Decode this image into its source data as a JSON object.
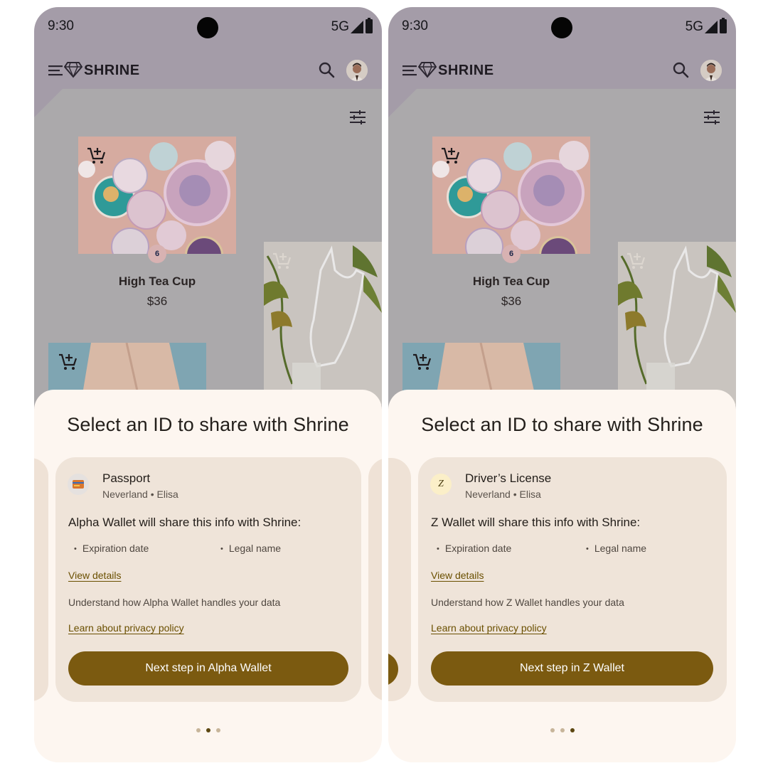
{
  "screens": [
    {
      "status": {
        "time": "9:30",
        "network": "5G"
      },
      "app": {
        "brand": "SHRINE"
      },
      "product": {
        "name": "High Tea Cup",
        "price": "$36",
        "badge": "6"
      },
      "dialog": {
        "title": "Select an ID to share with Shrine",
        "card": {
          "id_name": "Passport",
          "id_subtitle": "Neverland • Elisa",
          "icon": "passport-icon",
          "share_heading": "Alpha Wallet will share this info with Shrine:",
          "attributes": [
            "Expiration date",
            "Legal name"
          ],
          "view_details": "View details",
          "understand_text": "Understand how Alpha Wallet handles your data",
          "privacy_link": "Learn about privacy policy",
          "button_label": "Next step in Alpha Wallet"
        },
        "pager": {
          "count": 3,
          "active": 1
        }
      }
    },
    {
      "status": {
        "time": "9:30",
        "network": "5G"
      },
      "app": {
        "brand": "SHRINE"
      },
      "product": {
        "name": "High Tea Cup",
        "price": "$36",
        "badge": "6"
      },
      "dialog": {
        "title": "Select an ID to share with Shrine",
        "card": {
          "id_name": "Driver’s License",
          "id_subtitle": "Neverland • Elisa",
          "icon": "z-wallet-icon",
          "icon_letter": "Z",
          "share_heading": "Z Wallet will share this info with Shrine:",
          "attributes": [
            "Expiration date",
            "Legal name"
          ],
          "view_details": "View details",
          "understand_text": "Understand how Z Wallet handles your data",
          "privacy_link": "Learn about privacy policy",
          "button_label": "Next step in Z Wallet"
        },
        "pager": {
          "count": 3,
          "active": 2
        }
      }
    }
  ],
  "colors": {
    "scrim": "#a49ca8",
    "sheet": "#fdf6f0",
    "card": "#efe4d9",
    "primary_button": "#7b5a10",
    "link": "#6a4f00"
  }
}
